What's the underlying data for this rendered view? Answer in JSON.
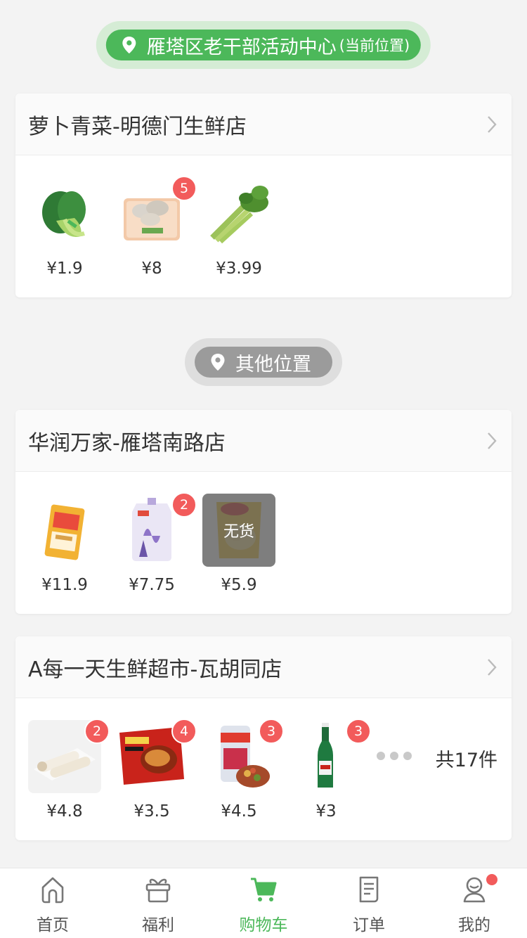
{
  "current_location": {
    "name": "雁塔区老干部活动中心",
    "suffix": "(当前位置)"
  },
  "other_location": {
    "label": "其他位置"
  },
  "stores": [
    {
      "name": "萝卜青菜-明德门生鲜店",
      "items": [
        {
          "price": "¥1.9",
          "badge": null,
          "icon": "bok-choy-image",
          "sold_out": false
        },
        {
          "price": "¥8",
          "badge": "5",
          "icon": "mushroom-box-image",
          "sold_out": false
        },
        {
          "price": "¥3.99",
          "badge": null,
          "icon": "celery-image",
          "sold_out": false
        }
      ]
    },
    {
      "name": "华润万家-雁塔南路店",
      "items": [
        {
          "price": "¥11.9",
          "badge": null,
          "icon": "snack-pack-image",
          "sold_out": false
        },
        {
          "price": "¥7.75",
          "badge": "2",
          "icon": "detergent-pouch-image",
          "sold_out": false
        },
        {
          "price": "¥5.9",
          "badge": null,
          "icon": "chips-bag-image",
          "sold_out": true,
          "sold_out_label": "无货"
        }
      ]
    },
    {
      "name": "A每一天生鲜超市-瓦胡同店",
      "items": [
        {
          "price": "¥4.8",
          "badge": "2",
          "icon": "rice-cake-image",
          "sold_out": false
        },
        {
          "price": "¥3.5",
          "badge": "4",
          "icon": "instant-noodle-image",
          "sold_out": false
        },
        {
          "price": "¥4.5",
          "badge": "3",
          "icon": "congee-can-image",
          "sold_out": false
        },
        {
          "price": "¥3",
          "badge": "3",
          "icon": "beer-bottle-image",
          "sold_out": false
        }
      ],
      "total": "共17件"
    }
  ],
  "tabbar": {
    "items": [
      {
        "label": "首页",
        "icon": "home-icon",
        "active": false
      },
      {
        "label": "福利",
        "icon": "gift-icon",
        "active": false
      },
      {
        "label": "购物车",
        "icon": "cart-icon",
        "active": true
      },
      {
        "label": "订单",
        "icon": "order-icon",
        "active": false
      },
      {
        "label": "我的",
        "icon": "profile-icon",
        "active": false,
        "notification_dot": true
      }
    ]
  },
  "colors": {
    "brand_green": "#4cb85a",
    "badge_red": "#f25b5b",
    "inactive_gray": "#9b9b9b"
  }
}
